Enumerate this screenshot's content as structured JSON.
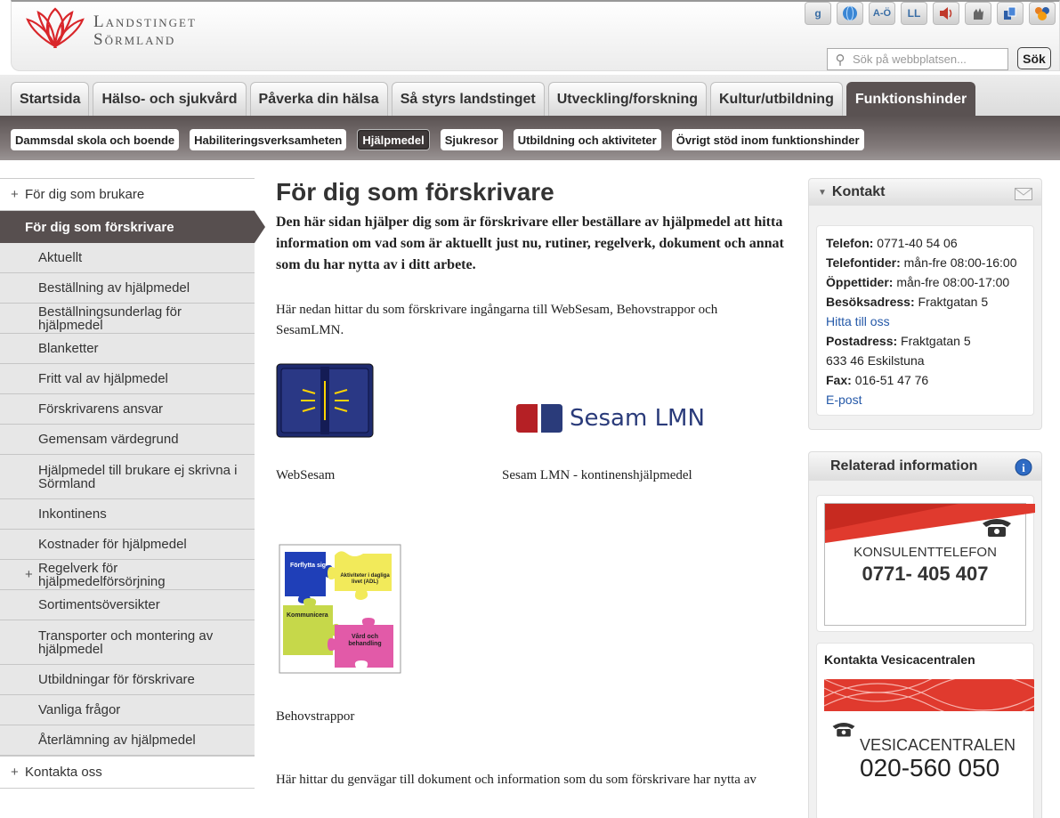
{
  "header": {
    "logo_line1": "Landstinget",
    "logo_line2": "Sörmland",
    "tools": [
      {
        "icon": "google-icon",
        "label": "g"
      },
      {
        "icon": "globe-icon",
        "label": ""
      },
      {
        "icon": "a-o-index-icon",
        "label": "A-Ö"
      },
      {
        "icon": "easy-read-icon",
        "label": "LL"
      },
      {
        "icon": "speaker-icon",
        "label": ""
      },
      {
        "icon": "sign-language-icon",
        "label": ""
      },
      {
        "icon": "sitemap-icon",
        "label": ""
      },
      {
        "icon": "people-icon",
        "label": ""
      }
    ],
    "search_placeholder": "Sök på webbplatsen...",
    "search_button": "Sök"
  },
  "tabs": [
    "Startsida",
    "Hälso- och sjukvård",
    "Påverka din hälsa",
    "Så styrs landstinget",
    "Utveckling/forskning",
    "Kultur/utbildning",
    "Funktionshinder"
  ],
  "subnav": [
    "Dammsdal skola och boende",
    "Habiliteringsverksamheten",
    "Hjälpmedel",
    "Sjukresor",
    "Utbildning och aktiviteter",
    "Övrigt stöd inom funktionshinder"
  ],
  "leftnav": {
    "top_item": "För dig som brukare",
    "current": "För dig som förskrivare",
    "items": [
      "Aktuellt",
      "Beställning av hjälpmedel",
      "Beställningsunderlag för hjälpmedel",
      "Blanketter",
      "Fritt val av hjälpmedel",
      "Förskrivarens ansvar",
      "Gemensam värdegrund",
      "Hjälpmedel till brukare ej skrivna i Sörmland",
      "Inkontinens",
      "Kostnader för hjälpmedel",
      "Regelverk för hjälpmedelförsörjning",
      "Sortimentsöversikter",
      "Transporter och montering av hjälpmedel",
      "Utbildningar för förskrivare",
      "Vanliga frågor",
      "Återlämning av hjälpmedel"
    ],
    "bottom_item": "Kontakta oss"
  },
  "main": {
    "title": "För dig som förskrivare",
    "intro": "Den här sidan hjälper dig som är förskrivare eller beställare av hjälpmedel att hitta information om vad som är aktuellt just nu, rutiner, regelverk, dokument och annat som du har nytta av i ditt arbete.",
    "para1": "Här nedan hittar du som förskrivare ingångarna till WebSesam, Behovstrappor och SesamLMN.",
    "websesam_caption": "WebSesam",
    "sesam_logo_text": "Sesam LMN",
    "sesam_caption": "Sesam LMN - kontinenshjälpmedel",
    "puzzle_labels": [
      "Förflytta sig",
      "Aktiviteter i dagliga livet (ADL)",
      "Kommunicera",
      "Vård och behandling"
    ],
    "behov_caption": "Behovstrappor",
    "para2": "Här hittar du genvägar till dokument och information som du som förskrivare har nytta av"
  },
  "contact": {
    "title": "Kontakt",
    "phone_label": "Telefon:",
    "phone": "0771-40 54 06",
    "phonetimes_label": "Telefontider:",
    "phonetimes": "mån-fre 08:00-16:00",
    "open_label": "Öppettider:",
    "open": "mån-fre 08:00-17:00",
    "visit_label": "Besöksadress:",
    "visit": "Fraktgatan 5",
    "find_link": "Hitta till oss",
    "post_label": "Postadress:",
    "post": "Fraktgatan 5",
    "post_city": "633 46 Eskilstuna",
    "fax_label": "Fax:",
    "fax": "016-51 47 76",
    "email_link": "E-post"
  },
  "related": {
    "title": "Relaterad information",
    "ad1_title": "KONSULENTTELEFON",
    "ad1_number": "0771- 405 407",
    "ad2_heading": "Kontakta Vesicacentralen",
    "ad2_title": "VESICACENTRALEN",
    "ad2_number": "020-560 050"
  },
  "colors": {
    "accent": "#574f4f",
    "logo_red": "#d9262a",
    "link": "#2458a8"
  }
}
